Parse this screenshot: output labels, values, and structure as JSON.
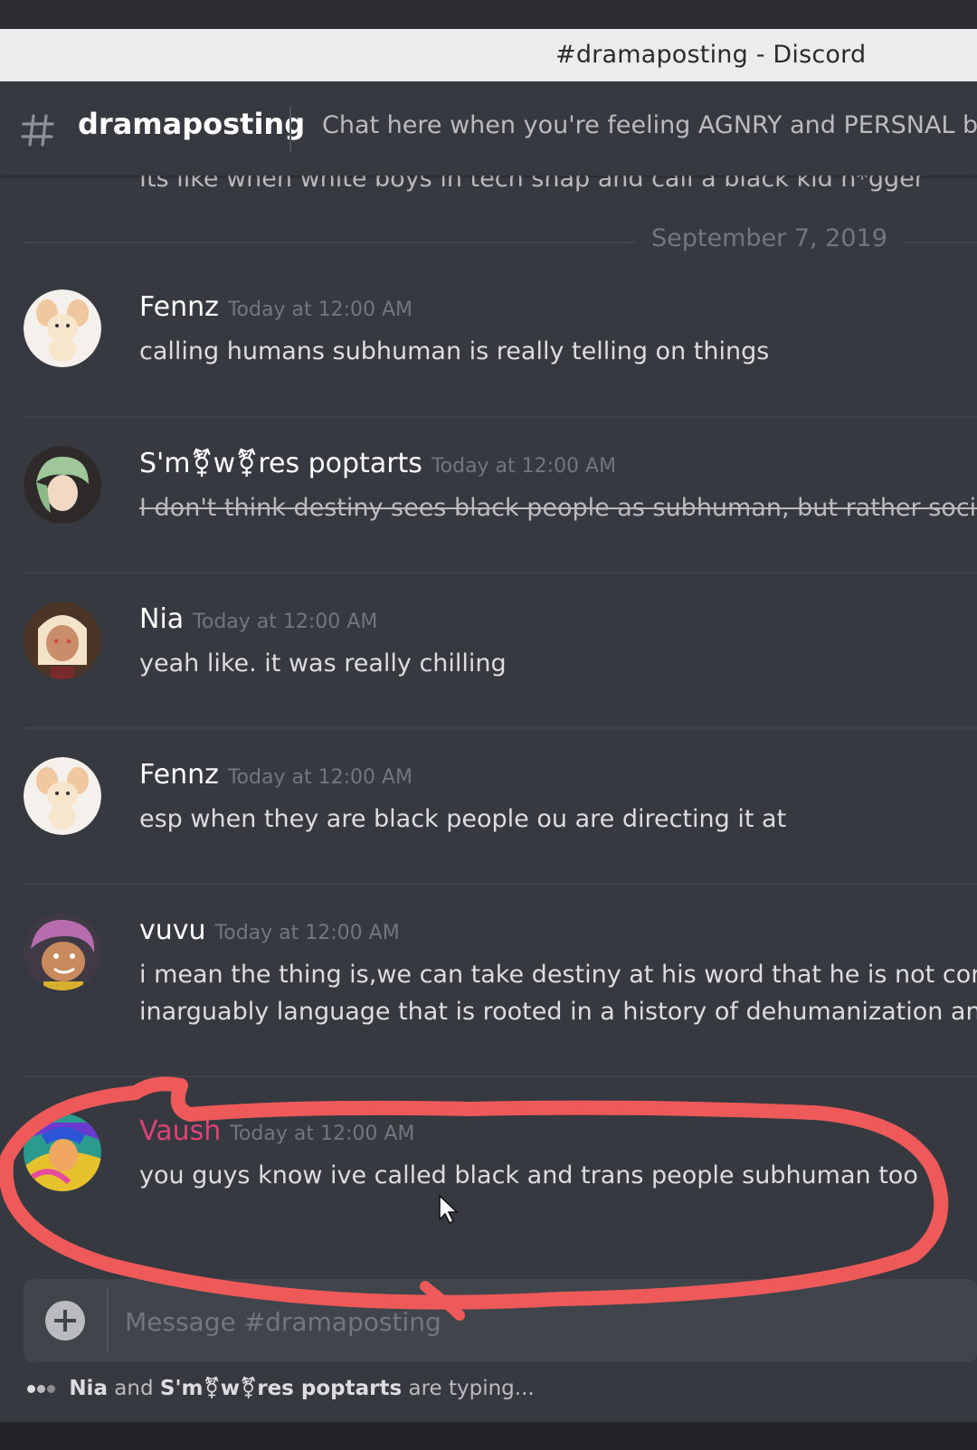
{
  "window": {
    "title": "#dramaposting - Discord"
  },
  "channel": {
    "name": "dramaposting",
    "topic": "Chat here when you're feeling AGNRY and PERSNAL but st",
    "icon": "hash-icon"
  },
  "cutoff_text": "Its like when white boys in tech snap and call a black kid n*gger",
  "date_divider": "September 7, 2019",
  "messages": [
    {
      "username": "Fennz",
      "timestamp": "Today at 12:00 AM",
      "lines": [
        "calling humans subhuman is really telling on things"
      ]
    },
    {
      "username": "S'm⚧w⚧res poptarts",
      "timestamp": "Today at 12:00 AM",
      "lines": [
        "I don't think destiny sees black people as subhuman, but rather sociali"
      ]
    },
    {
      "username": "Nia",
      "timestamp": "Today at 12:00 AM",
      "lines": [
        "yeah like. it was really chilling"
      ]
    },
    {
      "username": "Fennz",
      "timestamp": "Today at 12:00 AM",
      "lines": [
        "esp when they are black people ou are directing it at"
      ]
    },
    {
      "username": "vuvu",
      "timestamp": "Today at 12:00 AM",
      "lines": [
        "i mean the thing is,we can take destiny at his word that he is not conci",
        "inarguably  language that is rooted in a history of dehumanization and"
      ]
    },
    {
      "username": "Vaush",
      "timestamp": "Today at 12:00 AM",
      "lines": [
        "you guys know ive called black and trans people subhuman too"
      ]
    }
  ],
  "composer": {
    "placeholder": "Message #dramaposting",
    "value": ""
  },
  "typing": {
    "user1": "Nia",
    "and": "and",
    "user2": "S'm⚧w⚧res poptarts",
    "suffix": "are typing..."
  },
  "colors": {
    "background": "#36393f",
    "vaush_name": "#e04276",
    "annotation": "#ee5a5a"
  }
}
